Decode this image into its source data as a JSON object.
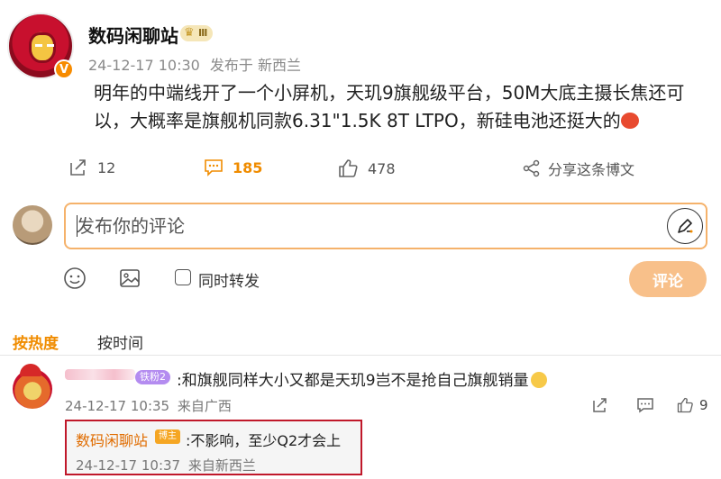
{
  "post": {
    "author": "数码闲聊站",
    "level_badge": "Ⅲ",
    "verified_mark": "V",
    "timestamp": "24-12-17 10:30",
    "location": "发布于 新西兰",
    "text": "明年的中端线开了一个小屏机，天玑9旗舰级平台，50M大底主摄长焦还可以，大概率是旗舰机同款6.31\"1.5K 8T LTPO，新硅电池还挺大的"
  },
  "actions": {
    "repost_count": "12",
    "comment_count": "185",
    "like_count": "478",
    "share_label": "分享这条博文"
  },
  "composer": {
    "placeholder": "发布你的评论",
    "sync_repost_label": "同时转发",
    "submit_label": "评论"
  },
  "sort_tabs": {
    "hot": "按热度",
    "time": "按时间"
  },
  "comment": {
    "fan_badge": "铁粉2",
    "text": ":和旗舰同样大小又都是天玑9岂不是抢自己旗舰销量",
    "timestamp": "24-12-17 10:35",
    "location": "来自广西",
    "like_count": "9"
  },
  "reply": {
    "author": "数码闲聊站",
    "badge": "博主",
    "text": ":不影响，至少Q2才会上",
    "timestamp": "24-12-17 10:37",
    "location": "来自新西兰"
  },
  "colors": {
    "accent": "#f08c00",
    "submit_disabled": "#f8c08a",
    "highlight_border": "#c0182a"
  }
}
